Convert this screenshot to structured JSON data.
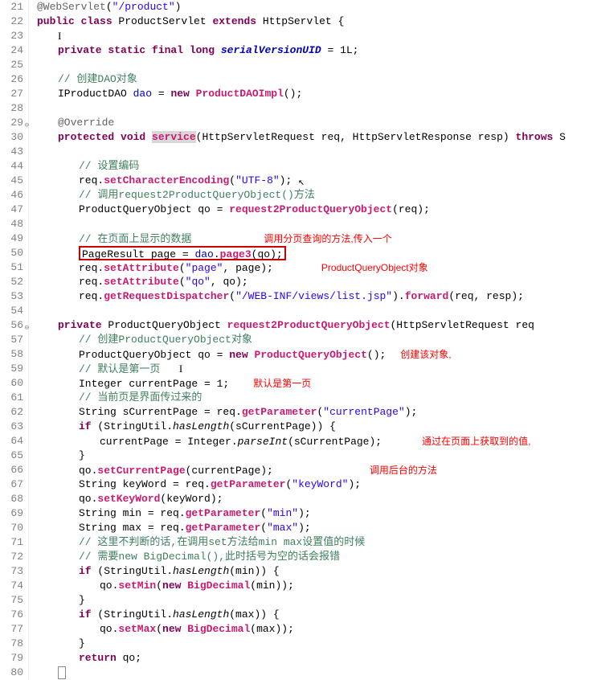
{
  "gutter": [
    "21",
    "22",
    "23",
    "24",
    "25",
    "26",
    "27",
    "28",
    "29",
    "30",
    "43",
    "44",
    "45",
    "46",
    "47",
    "48",
    "49",
    "50",
    "51",
    "52",
    "53",
    "54",
    "56",
    "57",
    "58",
    "59",
    "60",
    "61",
    "62",
    "63",
    "64",
    "65",
    "66",
    "67",
    "68",
    "69",
    "70",
    "71",
    "72",
    "73",
    "74",
    "75",
    "76",
    "77",
    "78",
    "79",
    "80"
  ],
  "folds": {
    "29": "⊖",
    "56": "⊖"
  },
  "code": {
    "l21_ann": "@WebServlet",
    "l21_str": "\"/product\"",
    "l22_kw1": "public class ",
    "l22_cls": "ProductServlet ",
    "l22_kw2": "extends ",
    "l22_ext": "HttpServlet {",
    "l24_kw": "private static final long ",
    "l24_field": "serialVersionUID",
    "l24_rest": " = 1L;",
    "l26_c": "// 创建DAO对象",
    "l27_a": "IProductDAO ",
    "l27_f": "dao",
    "l27_eq": " = ",
    "l27_kw": "new ",
    "l27_m": "ProductDAOImpl",
    "l27_p": "();",
    "l29_ann": "@Override",
    "l30_kw": "protected void ",
    "l30_m": "service",
    "l30_sig": "(HttpServletRequest req, HttpServletResponse resp) ",
    "l30_kw2": "throws ",
    "l30_rest": "S",
    "l44_c": "// 设置编码",
    "l45_a": "req.",
    "l45_m": "setCharacterEncoding",
    "l45_p": "(",
    "l45_s": "\"UTF-8\"",
    "l45_e": ");",
    "l46_c": "// 调用request2ProductQueryObject()方法",
    "l47_a": "ProductQueryObject qo = ",
    "l47_m": "request2ProductQueryObject",
    "l47_p": "(req);",
    "l49_c": "// 在页面上显示的数据",
    "l50_a": "PageResult page = ",
    "l50_f": "dao",
    "l50_dot": ".",
    "l50_m": "page3",
    "l50_p": "(qo);",
    "l51_a": "req.",
    "l51_m": "setAttribute",
    "l51_p": "(",
    "l51_s": "\"page\"",
    "l51_c": ", page);",
    "l52_a": "req.",
    "l52_m": "setAttribute",
    "l52_p": "(",
    "l52_s": "\"qo\"",
    "l52_c": ", qo);",
    "l53_a": "req.",
    "l53_m": "getRequestDispatcher",
    "l53_p": "(",
    "l53_s": "\"/WEB-INF/views/list.jsp\"",
    "l53_c": ").",
    "l53_m2": "forward",
    "l53_e": "(req, resp);",
    "l56_kw": "private ",
    "l56_t": "ProductQueryObject ",
    "l56_m": "request2ProductQueryObject",
    "l56_p": "(HttpServletRequest req",
    "l57_c": "// 创建ProductQueryObject对象",
    "l58_a": "ProductQueryObject qo = ",
    "l58_kw": "new ",
    "l58_m": "ProductQueryObject",
    "l58_p": "();",
    "l59_c": "// 默认是第一页",
    "l60_a": "Integer currentPage = 1;",
    "l61_c": "// 当前页是界面传过来的",
    "l62_a": "String sCurrentPage = req.",
    "l62_m": "getParameter",
    "l62_p": "(",
    "l62_s": "\"currentPage\"",
    "l62_e": ");",
    "l63_kw": "if ",
    "l63_a": "(StringUtil.",
    "l63_m": "hasLength",
    "l63_p": "(sCurrentPage)) {",
    "l64_a": "currentPage = Integer.",
    "l64_m": "parseInt",
    "l64_p": "(sCurrentPage);",
    "l65_b": "}",
    "l66_a": "qo.",
    "l66_m": "setCurrentPage",
    "l66_p": "(currentPage);",
    "l67_a": "String keyWord = req.",
    "l67_m": "getParameter",
    "l67_p": "(",
    "l67_s": "\"keyWord\"",
    "l67_e": ");",
    "l68_a": "qo.",
    "l68_m": "setKeyWord",
    "l68_p": "(keyWord);",
    "l69_a": "String min = req.",
    "l69_m": "getParameter",
    "l69_p": "(",
    "l69_s": "\"min\"",
    "l69_e": ");",
    "l70_a": "String max = req.",
    "l70_m": "getParameter",
    "l70_p": "(",
    "l70_s": "\"max\"",
    "l70_e": ");",
    "l71_c": "// 这里不判断的话,在调用set方法给min max设置值的时候",
    "l72_c": "// 需要new BigDecimal(),此时括号为空的话会报错",
    "l73_kw": "if ",
    "l73_a": "(StringUtil.",
    "l73_m": "hasLength",
    "l73_p": "(min)) {",
    "l74_a": "qo.",
    "l74_m": "setMin",
    "l74_p": "(",
    "l74_kw": "new ",
    "l74_m2": "BigDecimal",
    "l74_e": "(min));",
    "l75_b": "}",
    "l76_kw": "if ",
    "l76_a": "(StringUtil.",
    "l76_m": "hasLength",
    "l76_p": "(max)) {",
    "l77_a": "qo.",
    "l77_m": "setMax",
    "l77_p": "(",
    "l77_kw": "new ",
    "l77_m2": "BigDecimal",
    "l77_e": "(max));",
    "l78_b": "}",
    "l79_kw": "return ",
    "l79_a": "qo;"
  },
  "annotations": {
    "a49": "调用分页查询的方法,传入一个",
    "a51": "ProductQueryObject对象",
    "a58": "创建该对象,",
    "a60": "默认是第一页",
    "a64": "通过在页面上获取到的值,",
    "a66": "调用后台的方法"
  }
}
